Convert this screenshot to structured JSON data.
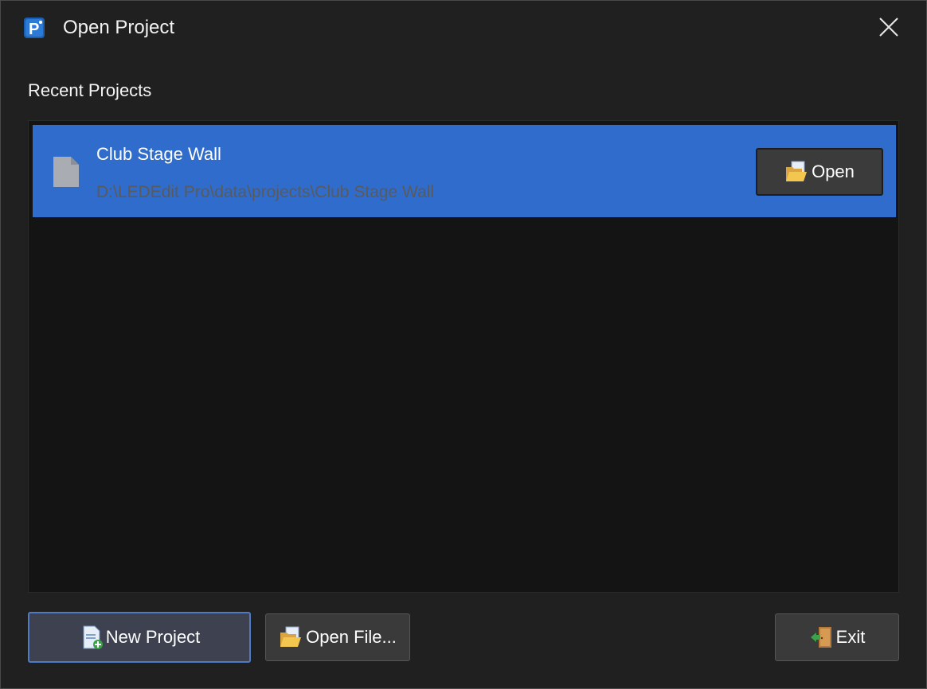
{
  "window": {
    "title": "Open Project",
    "app_icon": "app-logo-icon",
    "close_icon": "close-icon"
  },
  "recent": {
    "label": "Recent Projects",
    "items": [
      {
        "name": "Club Stage Wall",
        "path": "D:\\LEDEdit Pro\\data\\projects\\Club Stage Wall",
        "icon": "file-icon",
        "open_label": "Open",
        "selected": true
      }
    ]
  },
  "footer": {
    "new_project_label": "New Project",
    "open_file_label": "Open File...",
    "exit_label": "Exit"
  },
  "colors": {
    "background": "#202020",
    "list_background": "#141414",
    "selection": "#306ccb",
    "button": "#3a3a3a",
    "path_text": "#5a5a5a"
  }
}
